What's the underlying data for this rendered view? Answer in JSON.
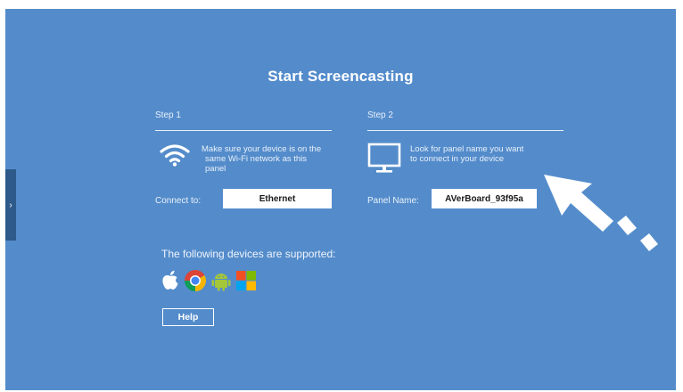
{
  "side_tab": {
    "icon": "chevron-right-icon",
    "glyph": "›"
  },
  "title": "Start Screencasting",
  "step1": {
    "label": "Step 1",
    "icon": "wifi-icon",
    "description_lines": [
      "Make sure your device is on the",
      "same Wi-Fi network as this",
      "panel"
    ],
    "connect_label": "Connect to:",
    "connect_value": "Ethernet"
  },
  "step2": {
    "label": "Step 2",
    "icon": "monitor-icon",
    "description_lines": [
      "Look for panel name you want",
      "to connect in your device"
    ],
    "panel_label": "Panel Name:",
    "panel_value": "AVerBoard_93f95a"
  },
  "supported": {
    "text": "The following devices are supported:",
    "icons": [
      "apple-icon",
      "chrome-icon",
      "android-icon",
      "windows-icon"
    ]
  },
  "help_label": "Help",
  "arrow_icon": "pointer-arrow-icon",
  "colors": {
    "background": "#548ccb",
    "side_tab": "#2d5a8a",
    "text": "#ffffff",
    "android": "#a4c639",
    "windows_red": "#f25022",
    "windows_green": "#7fba00",
    "windows_blue": "#00a4ef",
    "windows_yellow": "#ffb900"
  }
}
